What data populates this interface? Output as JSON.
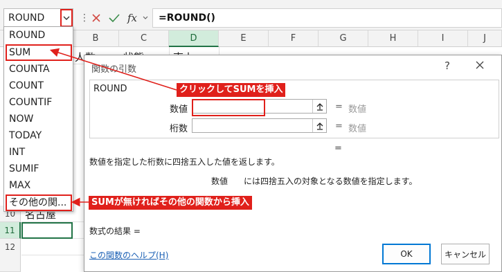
{
  "namebox": {
    "value": "ROUND"
  },
  "formula_bar": {
    "separator": "⋮",
    "cancel_symbol": "✕",
    "enter_symbol": "✓",
    "fx_label": "fx",
    "formula": "=ROUND()"
  },
  "columns": [
    "B",
    "C",
    "D",
    "E",
    "F",
    "G",
    "H",
    "I",
    "J"
  ],
  "selected_column": "D",
  "rows": [
    "10",
    "11",
    "12"
  ],
  "selected_row": "11",
  "cells": {
    "row10_col_a": "名古屋",
    "row1_col_b": "人数",
    "row1_col_c": "状態",
    "row1_col_d": "売上"
  },
  "dropdown": {
    "items": [
      "ROUND",
      "SUM",
      "COUNTA",
      "COUNT",
      "COUNTIF",
      "NOW",
      "TODAY",
      "INT",
      "SUMIF",
      "MAX",
      "その他の関..."
    ]
  },
  "dialog": {
    "title": "関数の引数",
    "help_symbol": "?",
    "function_name": "ROUND",
    "args": [
      {
        "label": "数値",
        "equals": "=",
        "value": "数値"
      },
      {
        "label": "桁数",
        "equals": "=",
        "value": "数値"
      }
    ],
    "result_equals": "=",
    "description": "数値を指定した桁数に四捨五入した値を返します。",
    "arg_description_label": "数値",
    "arg_description": "には四捨五入の対象となる数値を指定します。",
    "formula_result": "数式の結果 =",
    "help_link": "この関数のヘルプ(H)",
    "ok_label": "OK",
    "cancel_label": "キャンセル"
  },
  "callouts": {
    "click_sum": "クリックしてSUMを挿入",
    "no_sum": "SUMが無ければその他の関数から挿入"
  },
  "colors": {
    "accent_red": "#e0201b",
    "excel_green": "#217346",
    "link_blue": "#1a5fb4"
  }
}
